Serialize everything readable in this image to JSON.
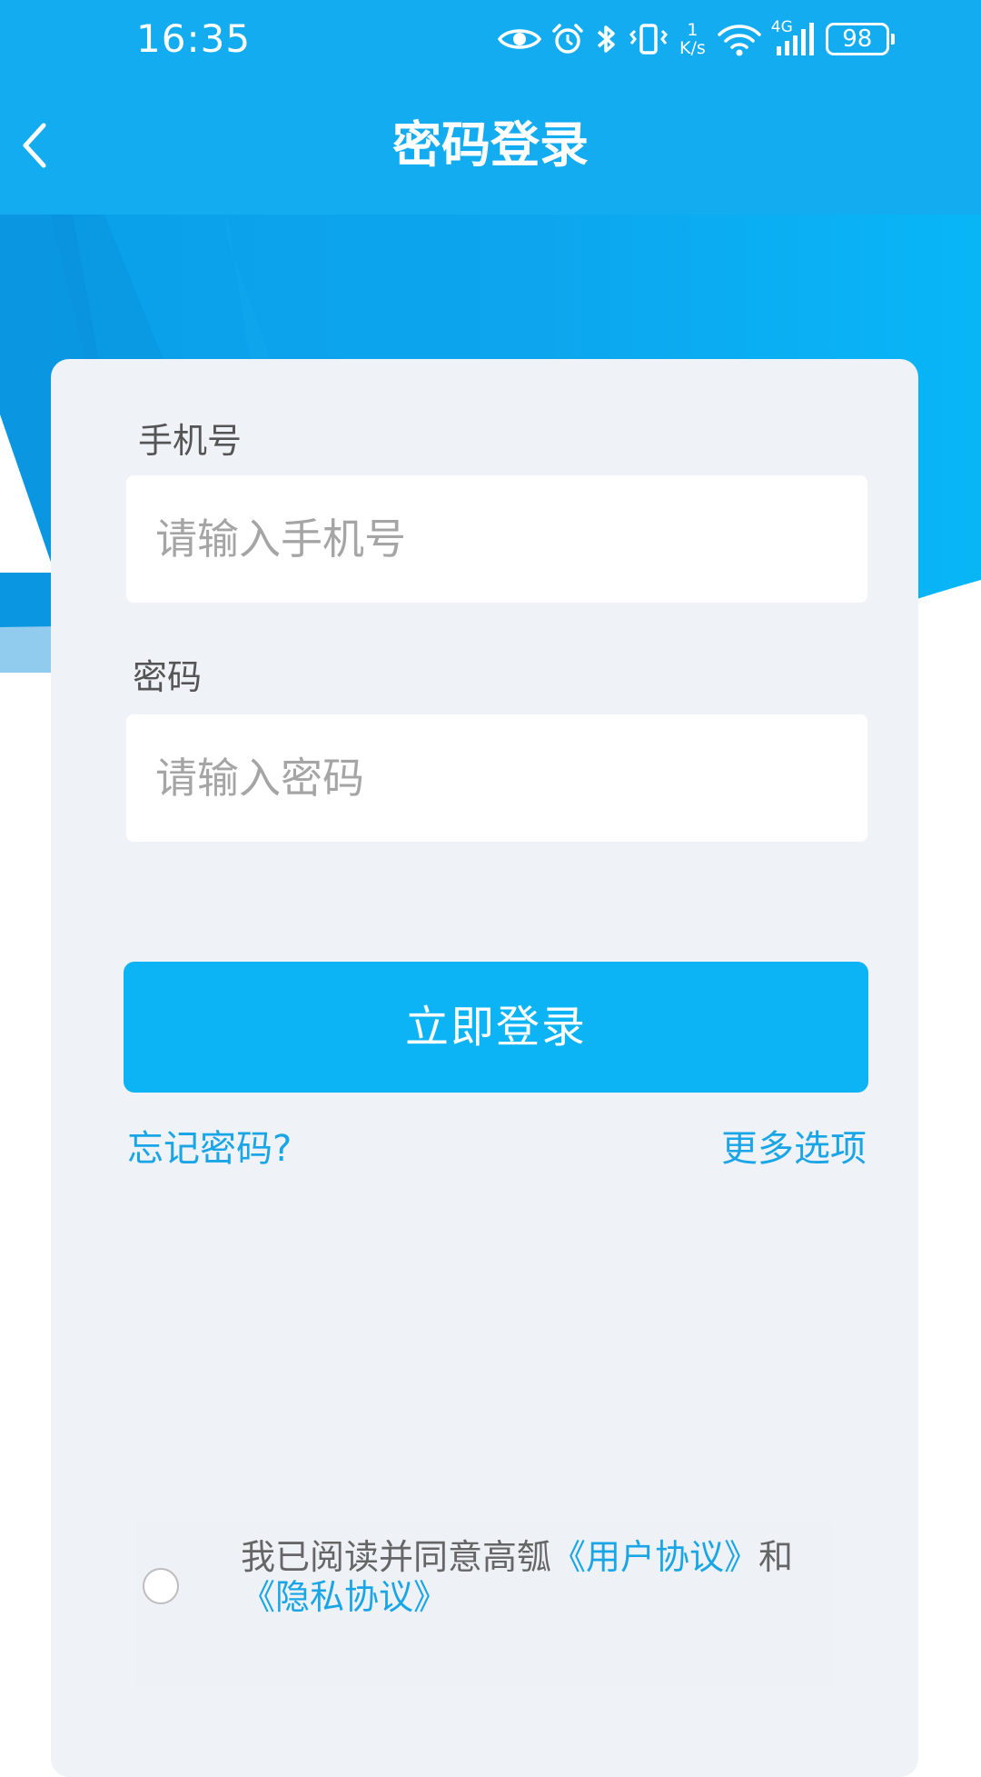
{
  "status_bar": {
    "time": "16:35",
    "net_speed_value": "1",
    "net_speed_unit": "K/s",
    "network_type": "4G",
    "battery": "98"
  },
  "header": {
    "title": "密码登录"
  },
  "form": {
    "phone_label": "手机号",
    "phone_placeholder": "请输入手机号",
    "password_label": "密码",
    "password_placeholder": "请输入密码",
    "login_button": "立即登录",
    "forgot_password": "忘记密码?",
    "more_options": "更多选项"
  },
  "agreement": {
    "prefix": "我已阅读并同意高瓠",
    "user_agreement": "《用户协议》",
    "conjunction": "和",
    "privacy_policy": "《隐私协议》"
  },
  "colors": {
    "header_blue": "#14acf0",
    "button_blue": "#0db4f5",
    "link_blue": "#1aa6e6",
    "card_background": "#eff2f7"
  },
  "icons": {
    "back": "chevron-left-icon",
    "eye": "eye-icon",
    "alarm": "alarm-clock-icon",
    "bluetooth": "bluetooth-icon",
    "vibrate": "vibrate-icon",
    "wifi": "wifi-icon",
    "signal": "signal-icon",
    "battery": "battery-icon"
  }
}
